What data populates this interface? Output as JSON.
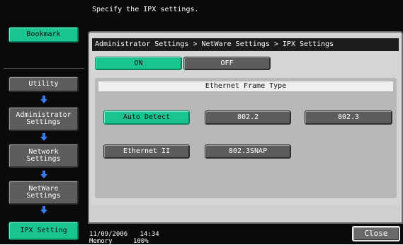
{
  "header": {
    "message": "Specify the IPX settings."
  },
  "sidebar": {
    "bookmark_label": "Bookmark",
    "utility_label": "Utility",
    "admin_label_1": "Administrator",
    "admin_label_2": "Settings",
    "network_label_1": "Network",
    "network_label_2": "Settings",
    "netware_label_1": "NetWare",
    "netware_label_2": "Settings",
    "ipx_label": "IPX Setting"
  },
  "breadcrumb": "Administrator Settings > NetWare Settings > IPX Settings",
  "toggle": {
    "on_label": "ON",
    "off_label": "OFF",
    "selected": "ON"
  },
  "frame_type": {
    "label": "Ethernet Frame Type",
    "options": [
      "Auto Detect",
      "802.2",
      "802.3",
      "Ethernet II",
      "802.3SNAP"
    ],
    "selected": "Auto Detect"
  },
  "status": {
    "date": "11/09/2006",
    "time": "14:34",
    "memory_label": "Memory",
    "memory_value": "100%"
  },
  "close_label": "Close",
  "colors": {
    "accent": "#19c491",
    "button_gray": "#5d5d5d",
    "panel": "#d5d5d5"
  }
}
